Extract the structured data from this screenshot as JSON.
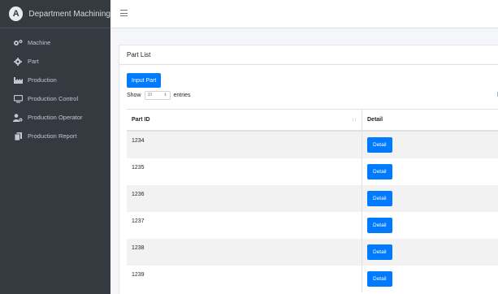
{
  "sidebar": {
    "brand_logo": "A",
    "brand": "Department Machining",
    "items": [
      {
        "label": "Machine",
        "icon": "gears-icon"
      },
      {
        "label": "Part",
        "icon": "gear-icon"
      },
      {
        "label": "Production",
        "icon": "industry-icon"
      },
      {
        "label": "Production Control",
        "icon": "monitor-icon"
      },
      {
        "label": "Production Operator",
        "icon": "user-gear-icon"
      },
      {
        "label": "Production Report",
        "icon": "copy-icon"
      }
    ]
  },
  "card": {
    "title": "Part List",
    "input_button": "Input Part",
    "show_label": "Show",
    "entries_value": "10",
    "entries_label": "entries"
  },
  "table": {
    "headers": [
      "Part ID",
      "Detail"
    ],
    "sort_icon": "↑↓",
    "rows": [
      {
        "id": "1234",
        "button": "Detail"
      },
      {
        "id": "1235",
        "button": "Detail"
      },
      {
        "id": "1236",
        "button": "Detail"
      },
      {
        "id": "1237",
        "button": "Detail"
      },
      {
        "id": "1238",
        "button": "Detail"
      },
      {
        "id": "1239",
        "button": "Detail"
      }
    ]
  },
  "colors": {
    "sidebar_bg": "#343a40",
    "primary": "#007bff",
    "stripe": "#f2f2f2"
  }
}
